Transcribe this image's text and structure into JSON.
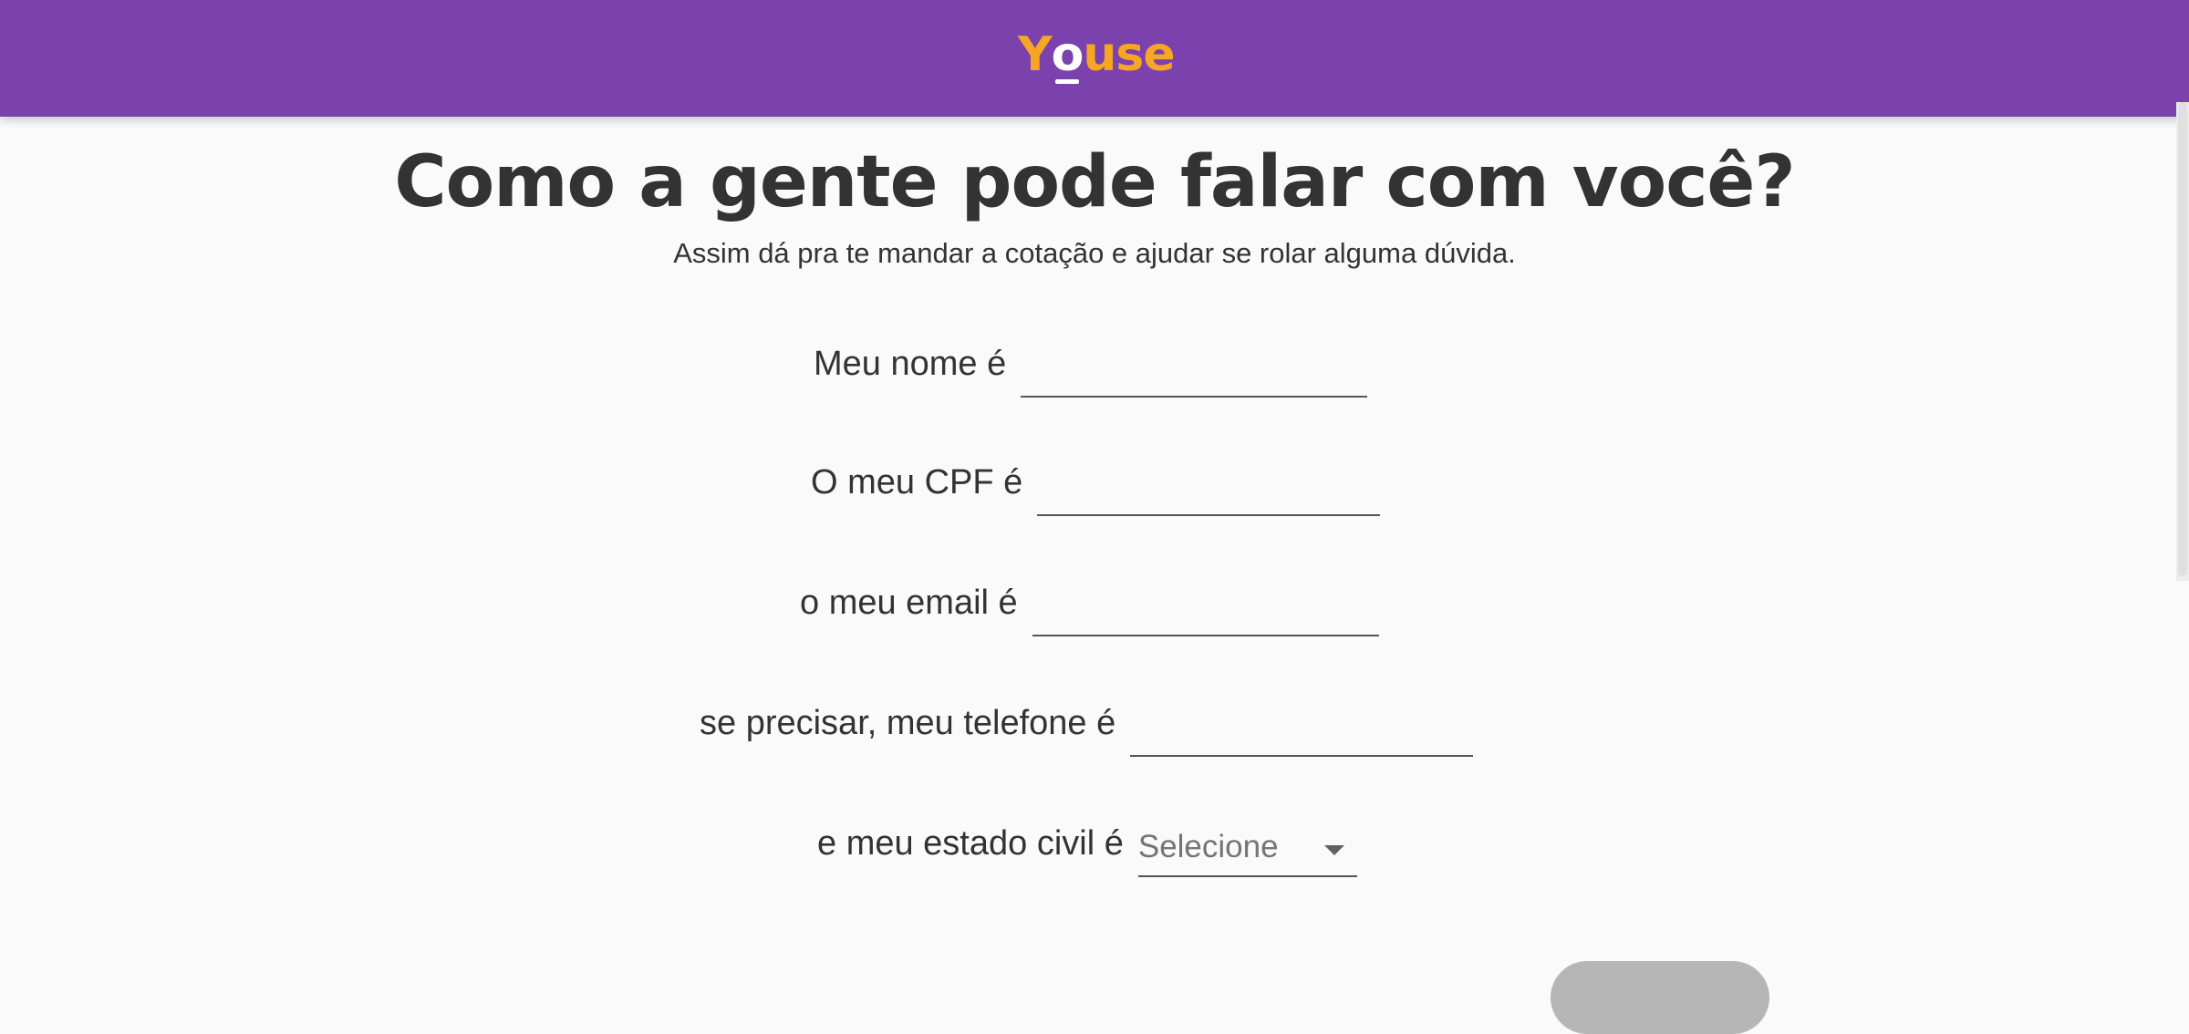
{
  "header": {
    "logo": {
      "y": "Y",
      "o": "o",
      "use": "use"
    },
    "background": "#7b42ad",
    "logo_color": "#f6a623"
  },
  "main": {
    "title": "Como a gente pode falar com você?",
    "subtitle": "Assim dá pra te mandar a cotação e ajudar se rolar alguma dúvida.",
    "fields": [
      {
        "label": "Meu nome é",
        "value": ""
      },
      {
        "label": "O meu CPF é",
        "value": ""
      },
      {
        "label": "o meu email é",
        "value": ""
      },
      {
        "label": "se precisar, meu telefone é",
        "value": ""
      }
    ],
    "marital_status": {
      "label": "e meu estado civil é",
      "selected": "Selecione"
    }
  },
  "colors": {
    "text": "#333333",
    "placeholder": "#757575",
    "button_disabled": "#b6b6b6"
  }
}
